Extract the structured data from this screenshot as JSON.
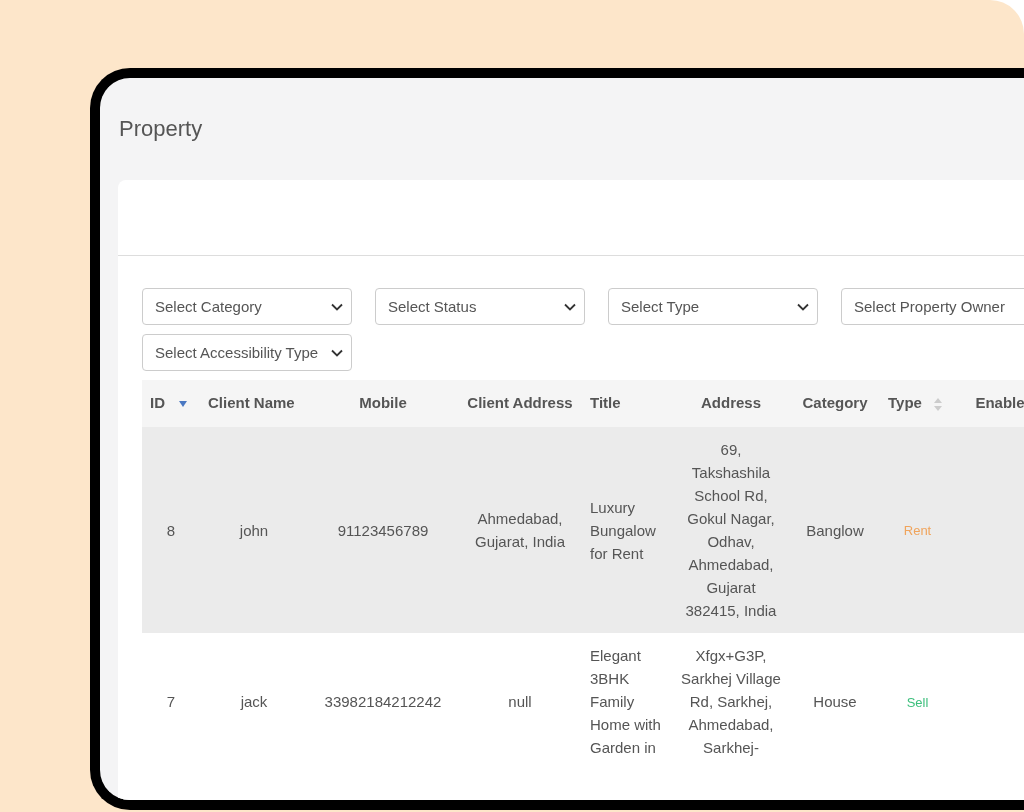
{
  "page": {
    "title": "Property"
  },
  "filters": [
    {
      "placeholder": "Select Category"
    },
    {
      "placeholder": "Select Status"
    },
    {
      "placeholder": "Select Type"
    },
    {
      "placeholder": "Select Property Owner"
    },
    {
      "placeholder": "Select Accessibility Type"
    }
  ],
  "table": {
    "columns": [
      {
        "label": "ID",
        "sortable": true,
        "sorted": true
      },
      {
        "label": "Client Name"
      },
      {
        "label": "Mobile"
      },
      {
        "label": "Client Address"
      },
      {
        "label": "Title"
      },
      {
        "label": "Address"
      },
      {
        "label": "Category"
      },
      {
        "label": "Type",
        "sortable": true,
        "sorted": false
      },
      {
        "label": "Enable"
      }
    ],
    "rows": [
      {
        "highlighted": true,
        "id": "8",
        "client_name": "john",
        "mobile": "91123456789",
        "client_address": "Ahmedabad, Gujarat, India",
        "title": "Luxury Bungalow for Rent",
        "address": "69, Takshashila School Rd, Gokul Nagar, Odhav, Ahmedabad, Gujarat 382415, India",
        "category": "Banglow",
        "type": {
          "text": "Rent",
          "color": "#f0a45c"
        }
      },
      {
        "highlighted": false,
        "id": "7",
        "client_name": "jack",
        "mobile": "33982184212242",
        "client_address": "null",
        "title": "Elegant 3BHK Family Home with Garden in",
        "address": "Xfgx+G3P, Sarkhej Village Rd, Sarkhej, Ahmedabad, Sarkhej-",
        "category": "House",
        "type": {
          "text": "Sell",
          "color": "#3cbf7c"
        }
      }
    ]
  }
}
